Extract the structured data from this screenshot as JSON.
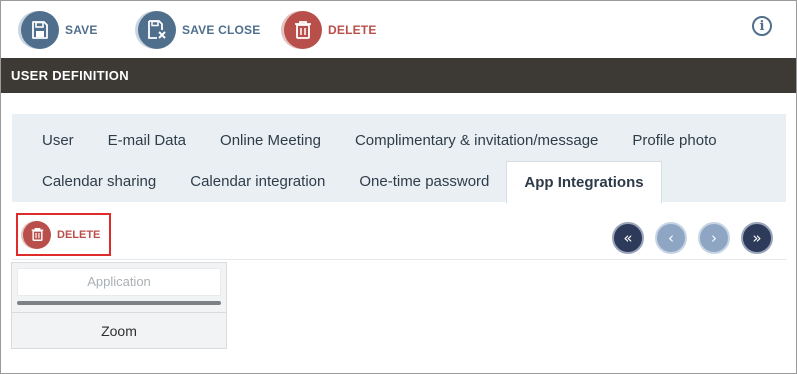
{
  "toolbar": {
    "save_label": "SAVE",
    "save_close_label": "SAVE CLOSE",
    "delete_label": "DELETE",
    "info_glyph": "i"
  },
  "title": "USER DEFINITION",
  "tabs": {
    "row1": [
      {
        "label": "User"
      },
      {
        "label": "E-mail Data"
      },
      {
        "label": "Online Meeting"
      },
      {
        "label": "Complimentary & invitation/message"
      },
      {
        "label": "Profile photo"
      }
    ],
    "row2": [
      {
        "label": "Calendar sharing"
      },
      {
        "label": "Calendar integration"
      },
      {
        "label": "One-time password"
      },
      {
        "label": "App Integrations",
        "active": true
      }
    ]
  },
  "actions": {
    "delete_label": "DELETE"
  },
  "pager": {
    "first": "«",
    "prev": "‹",
    "next": "›",
    "last": "»"
  },
  "grid": {
    "header": "Application",
    "rows": [
      {
        "application": "Zoom"
      }
    ]
  },
  "colors": {
    "primary_blue": "#4f6f8c",
    "danger_red": "#b94f4b",
    "title_bar": "#3d3a36",
    "tab_panel": "#e9eff3",
    "highlight_border": "#e02b2b"
  },
  "icons": {
    "save": "save-icon",
    "save_close": "save-close-icon",
    "delete": "trash-icon",
    "info": "info-icon"
  }
}
